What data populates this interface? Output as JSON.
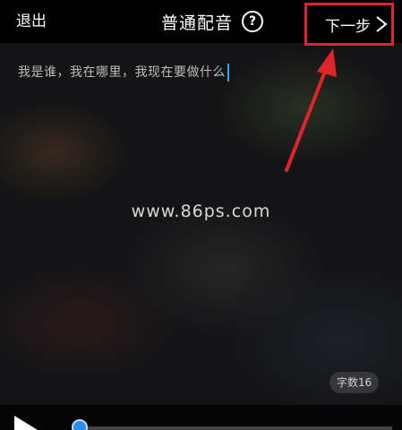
{
  "header": {
    "exit_label": "退出",
    "title": "普通配音",
    "help_icon": "help-icon",
    "next_label": "下一步"
  },
  "editor": {
    "text": "我是谁，我在哪里，我现在要做什么",
    "char_count_label": "字数16"
  },
  "watermark": "www.86ps.com",
  "colors": {
    "highlight_box": "#e0242a",
    "cursor": "#3aa0ff",
    "progress_knob": "#2a8cf0"
  },
  "player": {
    "play_icon": "play-icon",
    "progress": 0
  }
}
